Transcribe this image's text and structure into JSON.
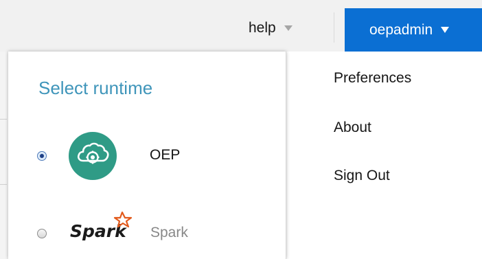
{
  "header": {
    "help_label": "help",
    "user_label": "oepadmin"
  },
  "runtime": {
    "title": "Select runtime",
    "options": [
      {
        "label": "OEP",
        "selected": true
      },
      {
        "label": "Spark",
        "selected": false
      }
    ],
    "spark_logo_text": "Spark"
  },
  "menu": {
    "items": [
      "Preferences",
      "About",
      "Sign Out"
    ]
  },
  "colors": {
    "accent": "#0b6fd3",
    "title": "#3f95ba",
    "oep_icon_bg": "#2f9b86",
    "spark_orange": "#e25a1c"
  }
}
